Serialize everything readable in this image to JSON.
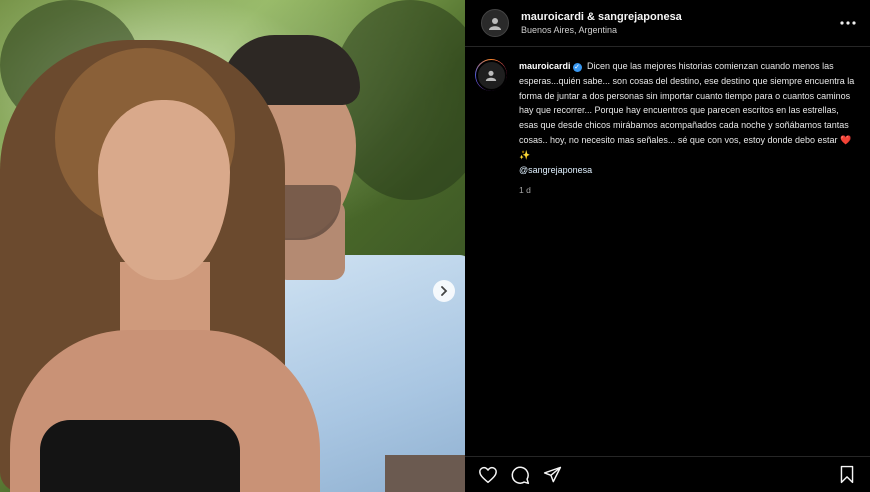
{
  "post": {
    "header": {
      "username": "mauroicardi",
      "collab_separator": "&",
      "collaborator": "sangrejaponesa",
      "location": "Buenos Aires, Argentina",
      "more_icon": "more-horizontal-icon"
    },
    "caption": {
      "username": "mauroicardi",
      "verified": true,
      "text": "Dicen que las mejores historias comienzan cuando menos las esperas...quién sabe... son cosas del destino, ese destino que siempre encuentra la forma de juntar a dos personas sin importar cuanto tiempo para o cuantos caminos hay que recorrer... Porque hay encuentros que parecen escritos en las estrellas, esas que desde chicos mirábamos acompañados cada noche y soñábamos tantas cosas.. hoy, no necesito mas señales... sé que con vos, estoy donde debo estar",
      "emoji": "❤️",
      "emoji2": "✨",
      "mention": "@sangrejaponesa",
      "time": "1 d"
    },
    "actions": {
      "like": "heart-icon",
      "comment": "comment-icon",
      "share": "share-icon",
      "save": "bookmark-icon"
    },
    "media": {
      "next_button": "chevron-right-icon"
    }
  }
}
